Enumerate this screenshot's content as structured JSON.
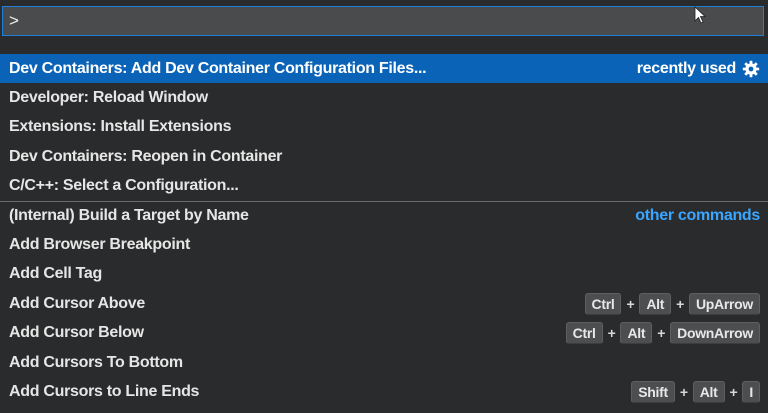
{
  "input": {
    "value": ">"
  },
  "items": [
    {
      "label": "Dev Containers: Add Dev Container Configuration Files...",
      "group": "recently used",
      "selected": true
    },
    {
      "label": "Developer: Reload Window"
    },
    {
      "label": "Extensions: Install Extensions"
    },
    {
      "label": "Dev Containers: Reopen in Container"
    },
    {
      "label": "C/C++: Select a Configuration..."
    },
    {
      "label": "(Internal) Build a Target by Name",
      "group": "other commands"
    },
    {
      "label": "Add Browser Breakpoint"
    },
    {
      "label": "Add Cell Tag"
    },
    {
      "label": "Add Cursor Above",
      "keys": [
        "Ctrl",
        "Alt",
        "UpArrow"
      ]
    },
    {
      "label": "Add Cursor Below",
      "keys": [
        "Ctrl",
        "Alt",
        "DownArrow"
      ]
    },
    {
      "label": "Add Cursors To Bottom"
    },
    {
      "label": "Add Cursors to Line Ends",
      "keys": [
        "Shift",
        "Alt",
        "I"
      ]
    }
  ],
  "key_separator": "+",
  "colors": {
    "selection": "#0a63b6",
    "link": "#3aa6ff",
    "focus_border": "#1e7fd6"
  }
}
